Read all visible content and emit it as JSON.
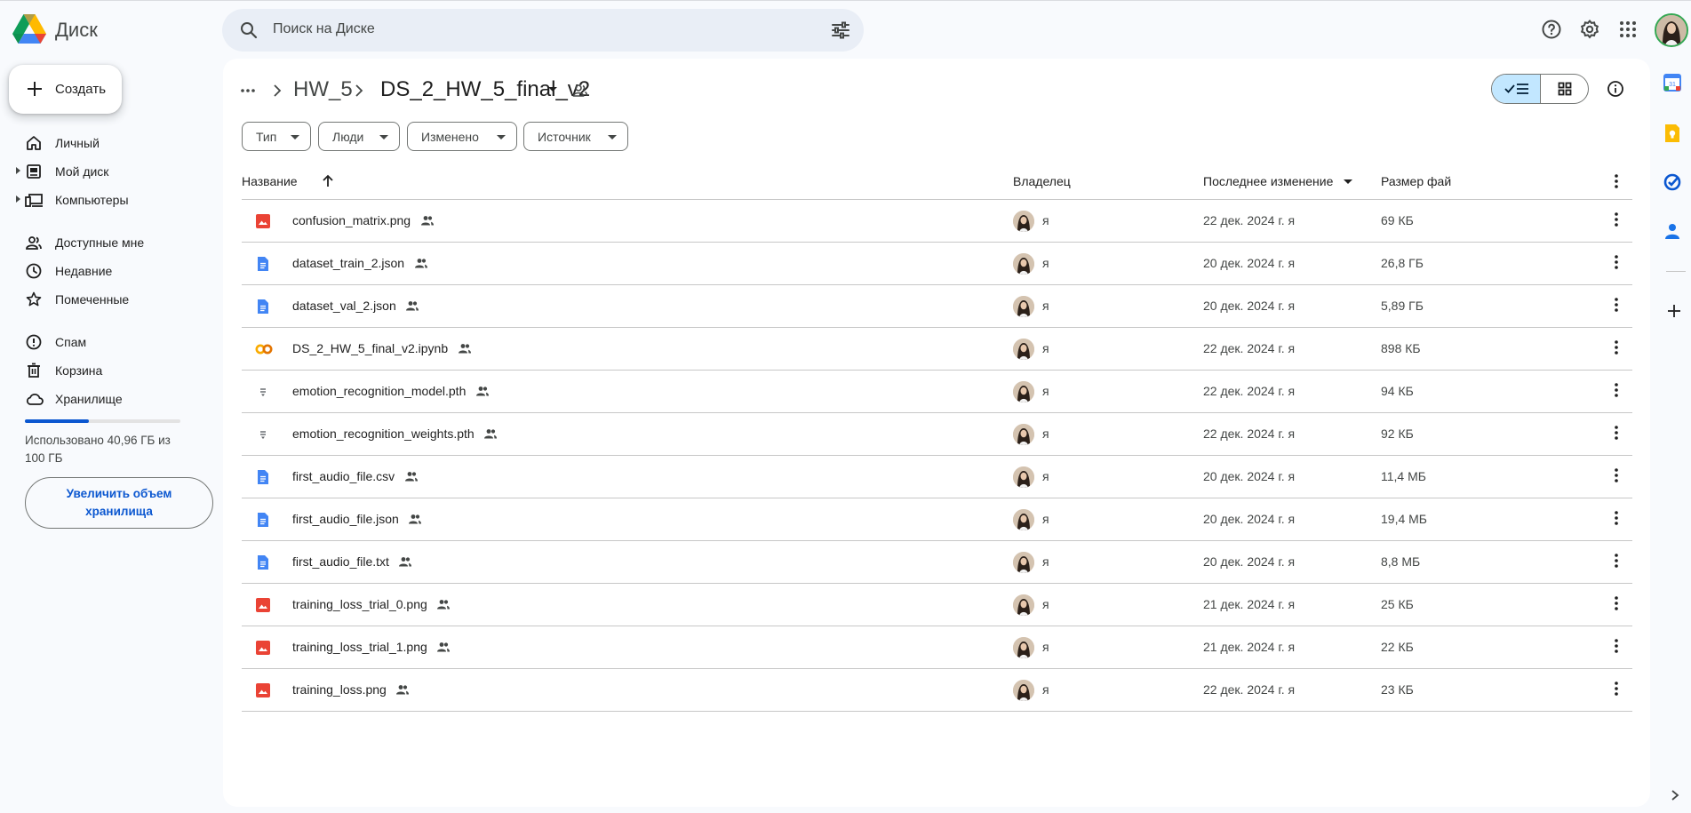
{
  "app": {
    "name": "Диск"
  },
  "search": {
    "placeholder": "Поиск на Диске"
  },
  "sidebar": {
    "create_label": "Создать",
    "items": [
      {
        "label": "Личный",
        "icon": "home-icon"
      },
      {
        "label": "Мой диск",
        "icon": "my-drive-icon"
      },
      {
        "label": "Компьютеры",
        "icon": "computers-icon"
      },
      {
        "label": "Доступные мне",
        "icon": "shared-with-me-icon"
      },
      {
        "label": "Недавние",
        "icon": "clock-icon"
      },
      {
        "label": "Помеченные",
        "icon": "star-icon"
      },
      {
        "label": "Спам",
        "icon": "spam-icon"
      },
      {
        "label": "Корзина",
        "icon": "trash-icon"
      },
      {
        "label": "Хранилище",
        "icon": "cloud-icon"
      }
    ],
    "storage": {
      "used_fraction": 0.41,
      "text": "Использовано 40,96 ГБ из 100 ГБ"
    },
    "upgrade_label": "Увеличить объем хранилища"
  },
  "breadcrumb": {
    "parent": "HW_5",
    "current": "DS_2_HW_5_final_v2"
  },
  "filters": [
    "Тип",
    "Люди",
    "Изменено",
    "Источник"
  ],
  "columns": {
    "name": "Название",
    "owner": "Владелец",
    "modified": "Последнее изменение",
    "size": "Размер фай"
  },
  "files": [
    {
      "name": "confusion_matrix.png",
      "type": "image",
      "owner": "я",
      "modified": "22 дек. 2024 г. я",
      "size": "69 КБ"
    },
    {
      "name": "dataset_train_2.json",
      "type": "doc",
      "owner": "я",
      "modified": "20 дек. 2024 г. я",
      "size": "26,8 ГБ"
    },
    {
      "name": "dataset_val_2.json",
      "type": "doc",
      "owner": "я",
      "modified": "20 дек. 2024 г. я",
      "size": "5,89 ГБ"
    },
    {
      "name": "DS_2_HW_5_final_v2.ipynb",
      "type": "colab",
      "owner": "я",
      "modified": "22 дек. 2024 г. я",
      "size": "898 КБ"
    },
    {
      "name": "emotion_recognition_model.pth",
      "type": "binary",
      "owner": "я",
      "modified": "22 дек. 2024 г. я",
      "size": "94 КБ"
    },
    {
      "name": "emotion_recognition_weights.pth",
      "type": "binary",
      "owner": "я",
      "modified": "22 дек. 2024 г. я",
      "size": "92 КБ"
    },
    {
      "name": "first_audio_file.csv",
      "type": "doc",
      "owner": "я",
      "modified": "20 дек. 2024 г. я",
      "size": "11,4 МБ"
    },
    {
      "name": "first_audio_file.json",
      "type": "doc",
      "owner": "я",
      "modified": "20 дек. 2024 г. я",
      "size": "19,4 МБ"
    },
    {
      "name": "first_audio_file.txt",
      "type": "doc",
      "owner": "я",
      "modified": "20 дек. 2024 г. я",
      "size": "8,8 МБ"
    },
    {
      "name": "training_loss_trial_0.png",
      "type": "image",
      "owner": "я",
      "modified": "21 дек. 2024 г. я",
      "size": "25 КБ"
    },
    {
      "name": "training_loss_trial_1.png",
      "type": "image",
      "owner": "я",
      "modified": "21 дек. 2024 г. я",
      "size": "22 КБ"
    },
    {
      "name": "training_loss.png",
      "type": "image",
      "owner": "я",
      "modified": "22 дек. 2024 г. я",
      "size": "23 КБ"
    }
  ],
  "colors": {
    "accent": "#0b57d0",
    "image_icon": "#ea4335",
    "doc_icon": "#4285f4",
    "colab_icon": "#f9ab00",
    "selected_toggle": "#c2e7ff"
  }
}
